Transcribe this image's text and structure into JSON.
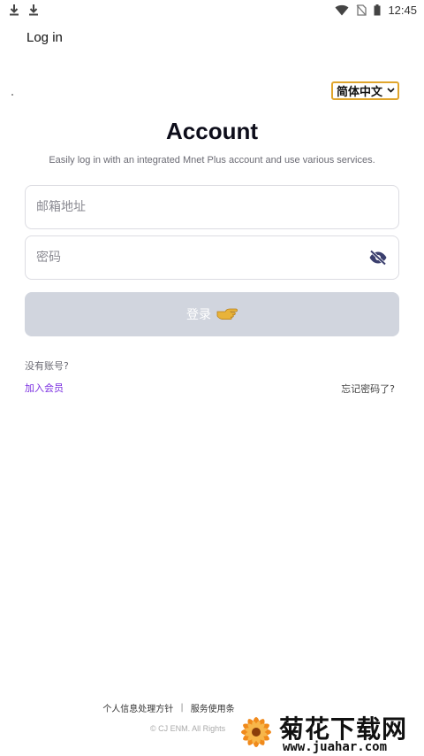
{
  "status_bar": {
    "time": "12:45",
    "icons": [
      "download-icon",
      "download-icon",
      "wifi-icon",
      "no-sim-icon",
      "battery-icon"
    ]
  },
  "header": {
    "title": "Log in"
  },
  "language": {
    "selected": "简体中文"
  },
  "main": {
    "heading": "Account",
    "subheading": "Easily log in with an integrated Mnet Plus account and use various services.",
    "email_placeholder": "邮箱地址",
    "password_placeholder": "密码",
    "login_label": "登录",
    "no_account": "没有账号?",
    "join_label": "加入会员",
    "forgot_label": "忘记密码了?"
  },
  "footer": {
    "privacy_label": "个人信息处理方针",
    "terms_label": "服务使用条",
    "copyright": "© CJ ENM. All Rights"
  },
  "watermark": {
    "title": "菊花下载网",
    "url": "www.juahar.com"
  },
  "colors": {
    "accent_purple": "#7a2ee0",
    "button_disabled": "#d1d5de",
    "lang_border": "#e0a52c"
  }
}
